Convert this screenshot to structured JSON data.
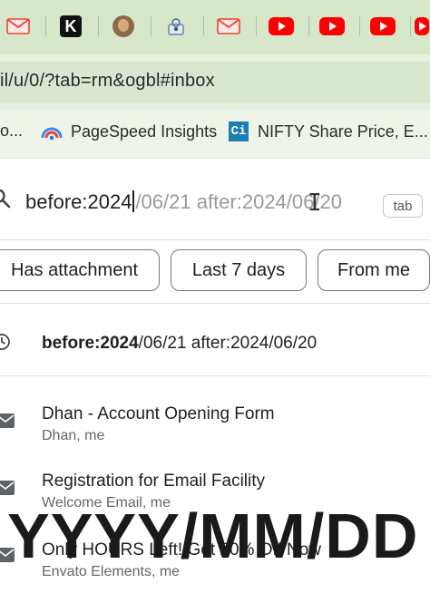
{
  "browser": {
    "address_bar": {
      "url": "il/u/0/?tab=rm&ogbl#inbox"
    },
    "tabs": [
      {
        "icon": "gmail-icon"
      },
      {
        "icon": "k-logo-icon",
        "letter": "K"
      },
      {
        "icon": "avatar-icon"
      },
      {
        "icon": "extension-icon"
      },
      {
        "icon": "gmail-icon"
      },
      {
        "icon": "youtube-icon"
      },
      {
        "icon": "youtube-icon"
      },
      {
        "icon": "youtube-icon"
      }
    ],
    "bookmarks": [
      {
        "label": "o...",
        "icon": "none"
      },
      {
        "label": "PageSpeed Insights",
        "icon": "pagespeed-icon"
      },
      {
        "label": "NIFTY Share Price, E...",
        "icon": "ci-icon",
        "icon_text": "Ci"
      }
    ]
  },
  "search": {
    "typed": "before:2024",
    "suggestion": "/06/21 after:2024/06/20",
    "tab_hint": "tab"
  },
  "chips": [
    "Has attachment",
    "Last 7 days",
    "From me"
  ],
  "recent_search": {
    "bold": "before:2024",
    "rest": "/06/21 after:2024/06/20"
  },
  "messages": [
    {
      "subject": "Dhan - Account Opening Form",
      "from": "Dhan, me"
    },
    {
      "subject": "Registration for Email Facility",
      "from": "Welcome Email, me"
    },
    {
      "subject": "Only HOURS Left! Get 20% Off Now",
      "from": "Envato Elements, me"
    }
  ],
  "overlay_caption": "YYYY/MM/DD",
  "colors": {
    "tabstrip_bg": "#d6e8c9",
    "omnibox_bg": "#d9e7ce",
    "youtube_red": "#ff0000",
    "gmail_red": "#ea4335"
  }
}
